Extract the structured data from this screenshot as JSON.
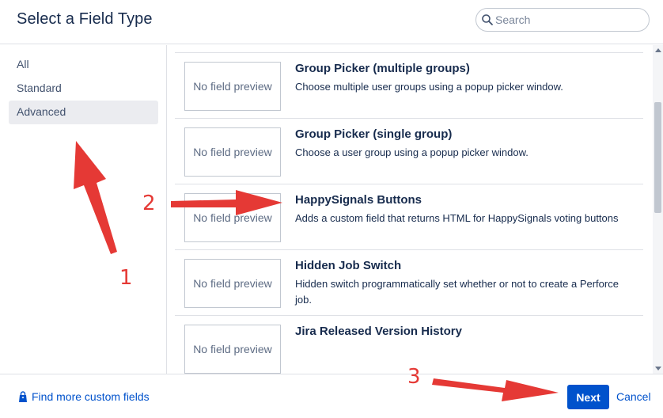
{
  "header": {
    "title": "Select a Field Type",
    "search_placeholder": "Search"
  },
  "sidebar": {
    "items": [
      {
        "label": "All"
      },
      {
        "label": "Standard"
      },
      {
        "label": "Advanced",
        "active": true
      }
    ]
  },
  "fields": [
    {
      "preview": "No field preview",
      "title": "Group Picker (multiple groups)",
      "desc": "Choose multiple user groups using a popup picker window."
    },
    {
      "preview": "No field preview",
      "title": "Group Picker (single group)",
      "desc": "Choose a user group using a popup picker window."
    },
    {
      "preview": "No field preview",
      "title": "HappySignals Buttons",
      "desc": "Adds a custom field that returns HTML for HappySignals voting buttons"
    },
    {
      "preview": "No field preview",
      "title": "Hidden Job Switch",
      "desc": "Hidden switch programmatically set whether or not to create a Perforce job."
    },
    {
      "preview": "No field preview",
      "title": "Jira Released Version History",
      "desc": ""
    }
  ],
  "footer": {
    "find_more": "Find more custom fields",
    "next": "Next",
    "cancel": "Cancel"
  },
  "annotations": {
    "labels": [
      "1",
      "2",
      "3"
    ],
    "color": "#e53935"
  },
  "colors": {
    "accent": "#0052cc",
    "text": "#172b4d",
    "active_bg": "#ebecf0"
  }
}
